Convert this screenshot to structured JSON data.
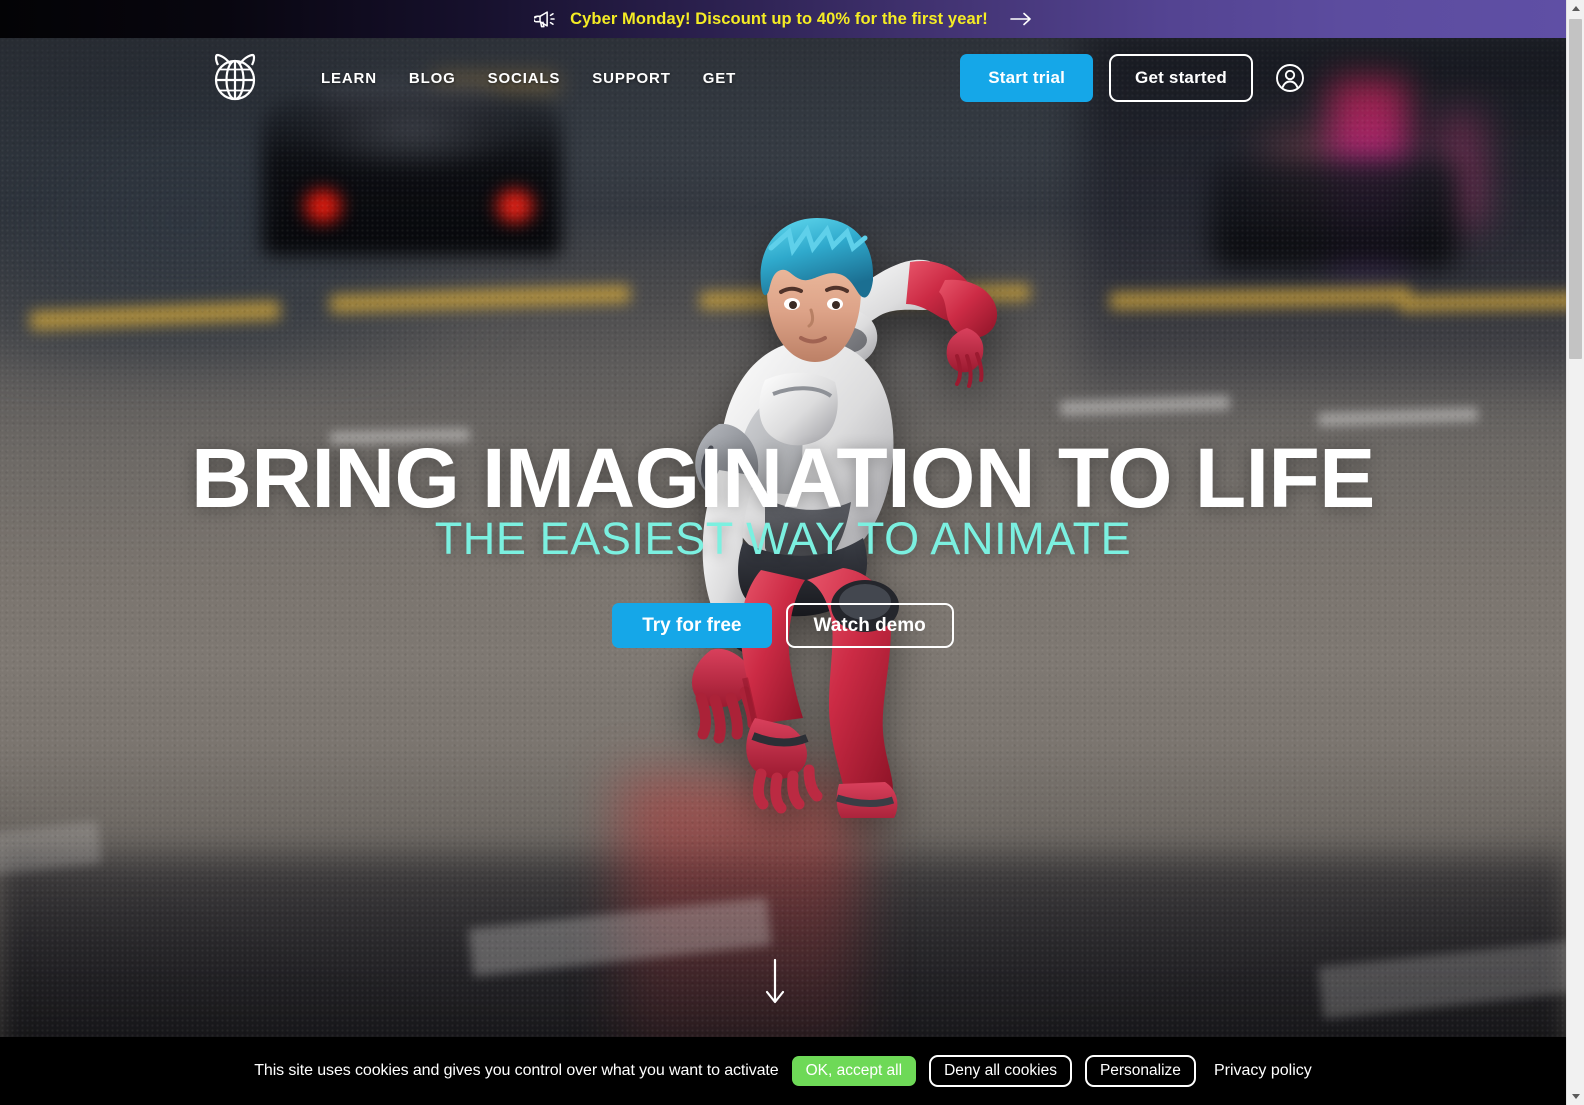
{
  "promo": {
    "icon": "megaphone-icon",
    "text": "Cyber Monday! Discount up to 40% for the first year!",
    "arrow_icon": "arrow-right-icon",
    "text_color": "#F5EC24",
    "gradient_from": "#030305",
    "gradient_to": "#5F4FA5"
  },
  "nav": {
    "logo_name": "cascadeur-logo",
    "links": [
      {
        "label": "LEARN"
      },
      {
        "label": "BLOG"
      },
      {
        "label": "SOCIALS"
      },
      {
        "label": "SUPPORT"
      },
      {
        "label": "GET"
      }
    ],
    "start_trial_label": "Start trial",
    "get_started_label": "Get started",
    "account_icon": "user-account-icon",
    "accent_color": "#15A7E8"
  },
  "hero": {
    "title": "BRING IMAGINATION TO LIFE",
    "subtitle": "THE EASIEST WAY TO ANIMATE",
    "subtitle_color": "#7BF0E0",
    "try_free_label": "Try for free",
    "watch_demo_label": "Watch demo",
    "scroll_icon": "arrow-down-icon"
  },
  "cookies": {
    "message": "This site uses cookies and gives you control over what you want to activate",
    "accept_label": "OK, accept all",
    "deny_label": "Deny all cookies",
    "personalize_label": "Personalize",
    "privacy_label": "Privacy policy",
    "accept_color": "#6ED957",
    "bar_color": "#000000"
  },
  "scrollbar": {
    "up_icon": "scroll-up-arrow-icon",
    "down_icon": "scroll-down-arrow-icon"
  }
}
